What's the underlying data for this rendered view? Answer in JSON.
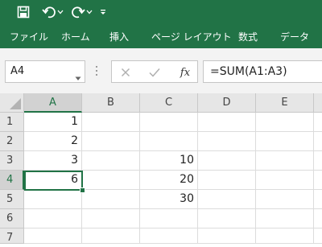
{
  "quick_access": {
    "save_icon": "save-icon",
    "undo_icon": "undo-icon",
    "redo_icon": "redo-icon",
    "customize_icon": "customize-qat-icon"
  },
  "ribbon_tabs": [
    "ファイル",
    "ホーム",
    "挿入",
    "ページ レイアウト",
    "数式",
    "データ"
  ],
  "name_box": {
    "value": "A4"
  },
  "formula_bar": {
    "cancel_icon": "cancel-icon",
    "enter_icon": "check-icon",
    "fx_label": "fx",
    "formula": "=SUM(A1:A3)"
  },
  "sheet": {
    "columns": [
      "A",
      "B",
      "C",
      "D",
      "E"
    ],
    "rows": [
      "1",
      "2",
      "3",
      "4",
      "5",
      "6",
      "7"
    ],
    "selected_cell": "A4",
    "cells": {
      "A1": "1",
      "A2": "2",
      "A3": "3",
      "A4": "6",
      "C3": "10",
      "C4": "20",
      "C5": "30"
    }
  },
  "colors": {
    "accent": "#217346"
  }
}
